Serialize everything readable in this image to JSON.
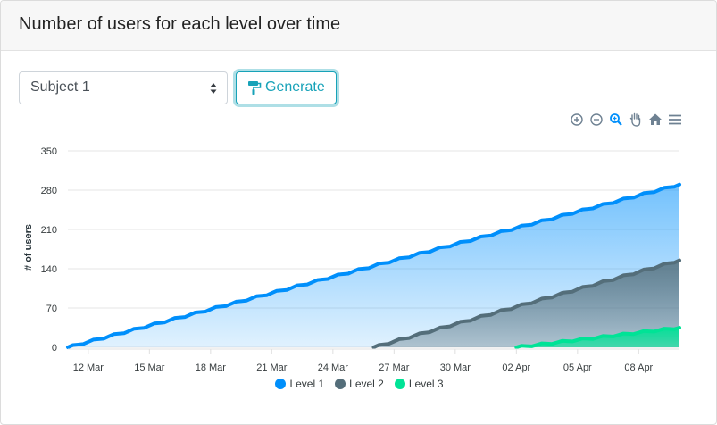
{
  "header": {
    "title": "Number of users for each level over time"
  },
  "controls": {
    "subject_value": "Subject 1",
    "generate_label": "Generate"
  },
  "toolbar": [
    "zoom-in-icon",
    "zoom-out-icon",
    "selection-zoom-icon",
    "pan-hand-icon",
    "reset-home-icon",
    "menu-icon"
  ],
  "colors": {
    "level1": "#008ffb",
    "level2": "#546e7a",
    "level3": "#00e396",
    "accent": "#17a2b8"
  },
  "chart_data": {
    "type": "area",
    "ylabel": "# of users",
    "ylim": [
      0,
      350
    ],
    "yticks": [
      "0",
      "70",
      "140",
      "210",
      "280",
      "350"
    ],
    "x_start": "11 Mar",
    "x_end": "10 Apr",
    "xticks": [
      "12 Mar",
      "15 Mar",
      "18 Mar",
      "21 Mar",
      "24 Mar",
      "27 Mar",
      "30 Mar",
      "02 Apr",
      "05 Apr",
      "08 Apr"
    ],
    "legend_position": "bottom",
    "series": [
      {
        "name": "Level 1",
        "x": [
          "11 Mar",
          "10 Apr"
        ],
        "y": [
          0,
          290
        ]
      },
      {
        "name": "Level 2",
        "x": [
          "26 Mar",
          "10 Apr"
        ],
        "y": [
          0,
          155
        ]
      },
      {
        "name": "Level 3",
        "x": [
          "02 Apr",
          "10 Apr"
        ],
        "y": [
          0,
          35
        ]
      }
    ]
  }
}
